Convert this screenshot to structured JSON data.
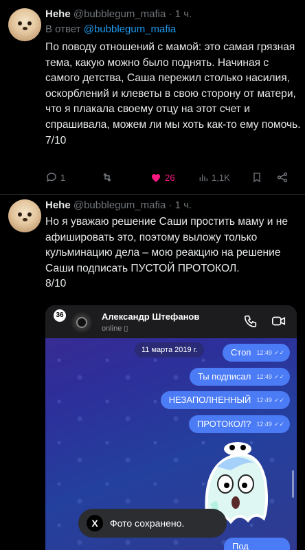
{
  "tweets": [
    {
      "name": "Hehe",
      "handle": "@bubblegum_mafia",
      "time": "· 1 ч.",
      "reply_prefix": "В ответ",
      "reply_handle": "@bubblegum_mafia",
      "text": "По поводу отношений с мамой: это самая грязная тема, какую можно было поднять. Начиная с самого детства, Саша пережил столько насилия, оскорблений и клеветы в свою сторону от матери, что я плакала своему отцу на этот счет и спрашивала, можем ли мы хоть как-то ему помочь.\n7/10",
      "actions": {
        "replies": "1",
        "retweets": "",
        "likes": "26",
        "views": "1,1K"
      }
    },
    {
      "name": "Hehe",
      "handle": "@bubblegum_mafia",
      "time": "· 1 ч.",
      "text": "Но я уважаю решение Саши простить маму и не афишировать это, поэтому выложу только кульминацию дела – мою реакцию на решение Саши подписать ПУСТОЙ ПРОТОКОЛ.\n8/10"
    }
  ],
  "media": {
    "unread_badge": "36",
    "contact_name": "Александр Штефанов",
    "contact_status": "online",
    "date": "11 марта 2019 г.",
    "messages": [
      {
        "text": "Стоп",
        "time": "12:49"
      },
      {
        "text": "Ты подписал",
        "time": "12:49"
      },
      {
        "text": "НЕЗАПОЛНЕННЫЙ",
        "time": "12:49"
      },
      {
        "text": "ПРОТОКОЛ?",
        "time": "12:49"
      }
    ],
    "last_bubble": "Под"
  },
  "toast": {
    "icon_label": "X",
    "text": "Фото сохранено."
  },
  "colors": {
    "accent": "#1d9bf0",
    "like": "#f91880",
    "bubble": "#4b7bf5"
  }
}
